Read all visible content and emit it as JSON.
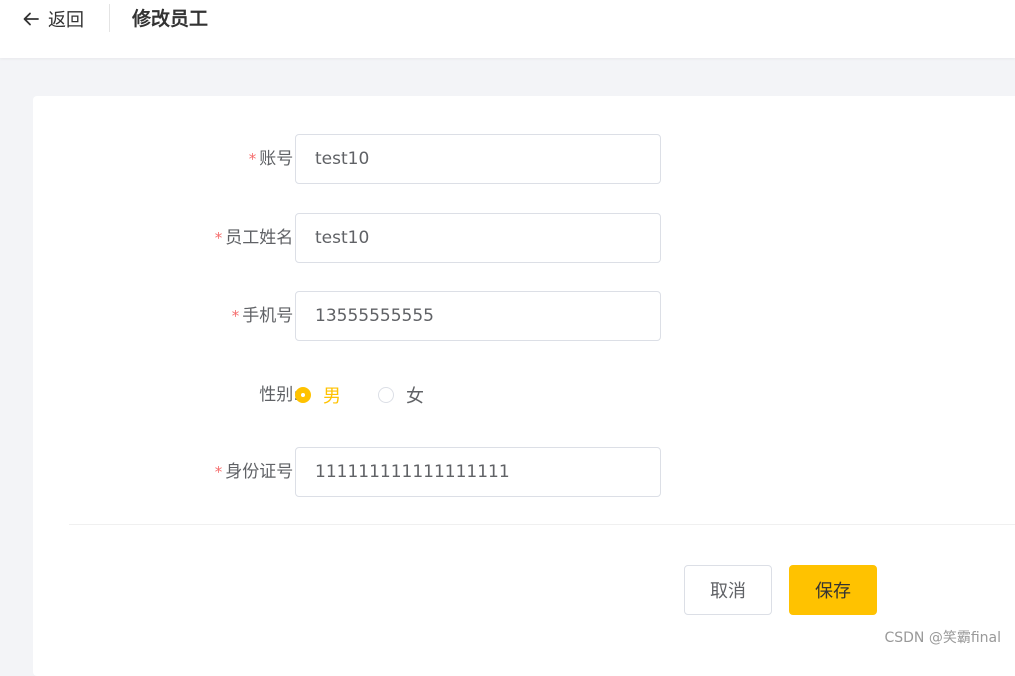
{
  "header": {
    "back_label": "返回",
    "title": "修改员工"
  },
  "form": {
    "required_mark": "*",
    "fields": [
      {
        "label": "账号:",
        "value": "test10",
        "required": true
      },
      {
        "label": "员工姓名:",
        "value": "test10",
        "required": true
      },
      {
        "label": "手机号:",
        "value": "13555555555",
        "required": true
      }
    ],
    "gender": {
      "label": "性别:",
      "options": [
        "男",
        "女"
      ],
      "selected": "男"
    },
    "id_card": {
      "label": "身份证号:",
      "value": "111111111111111111",
      "required": true
    }
  },
  "actions": {
    "cancel_label": "取消",
    "save_label": "保存"
  },
  "watermark": "CSDN @笑霸final",
  "colors": {
    "accent": "#ffc200",
    "required": "#f56c6c"
  },
  "icons": {
    "back": "arrow-left-icon"
  }
}
